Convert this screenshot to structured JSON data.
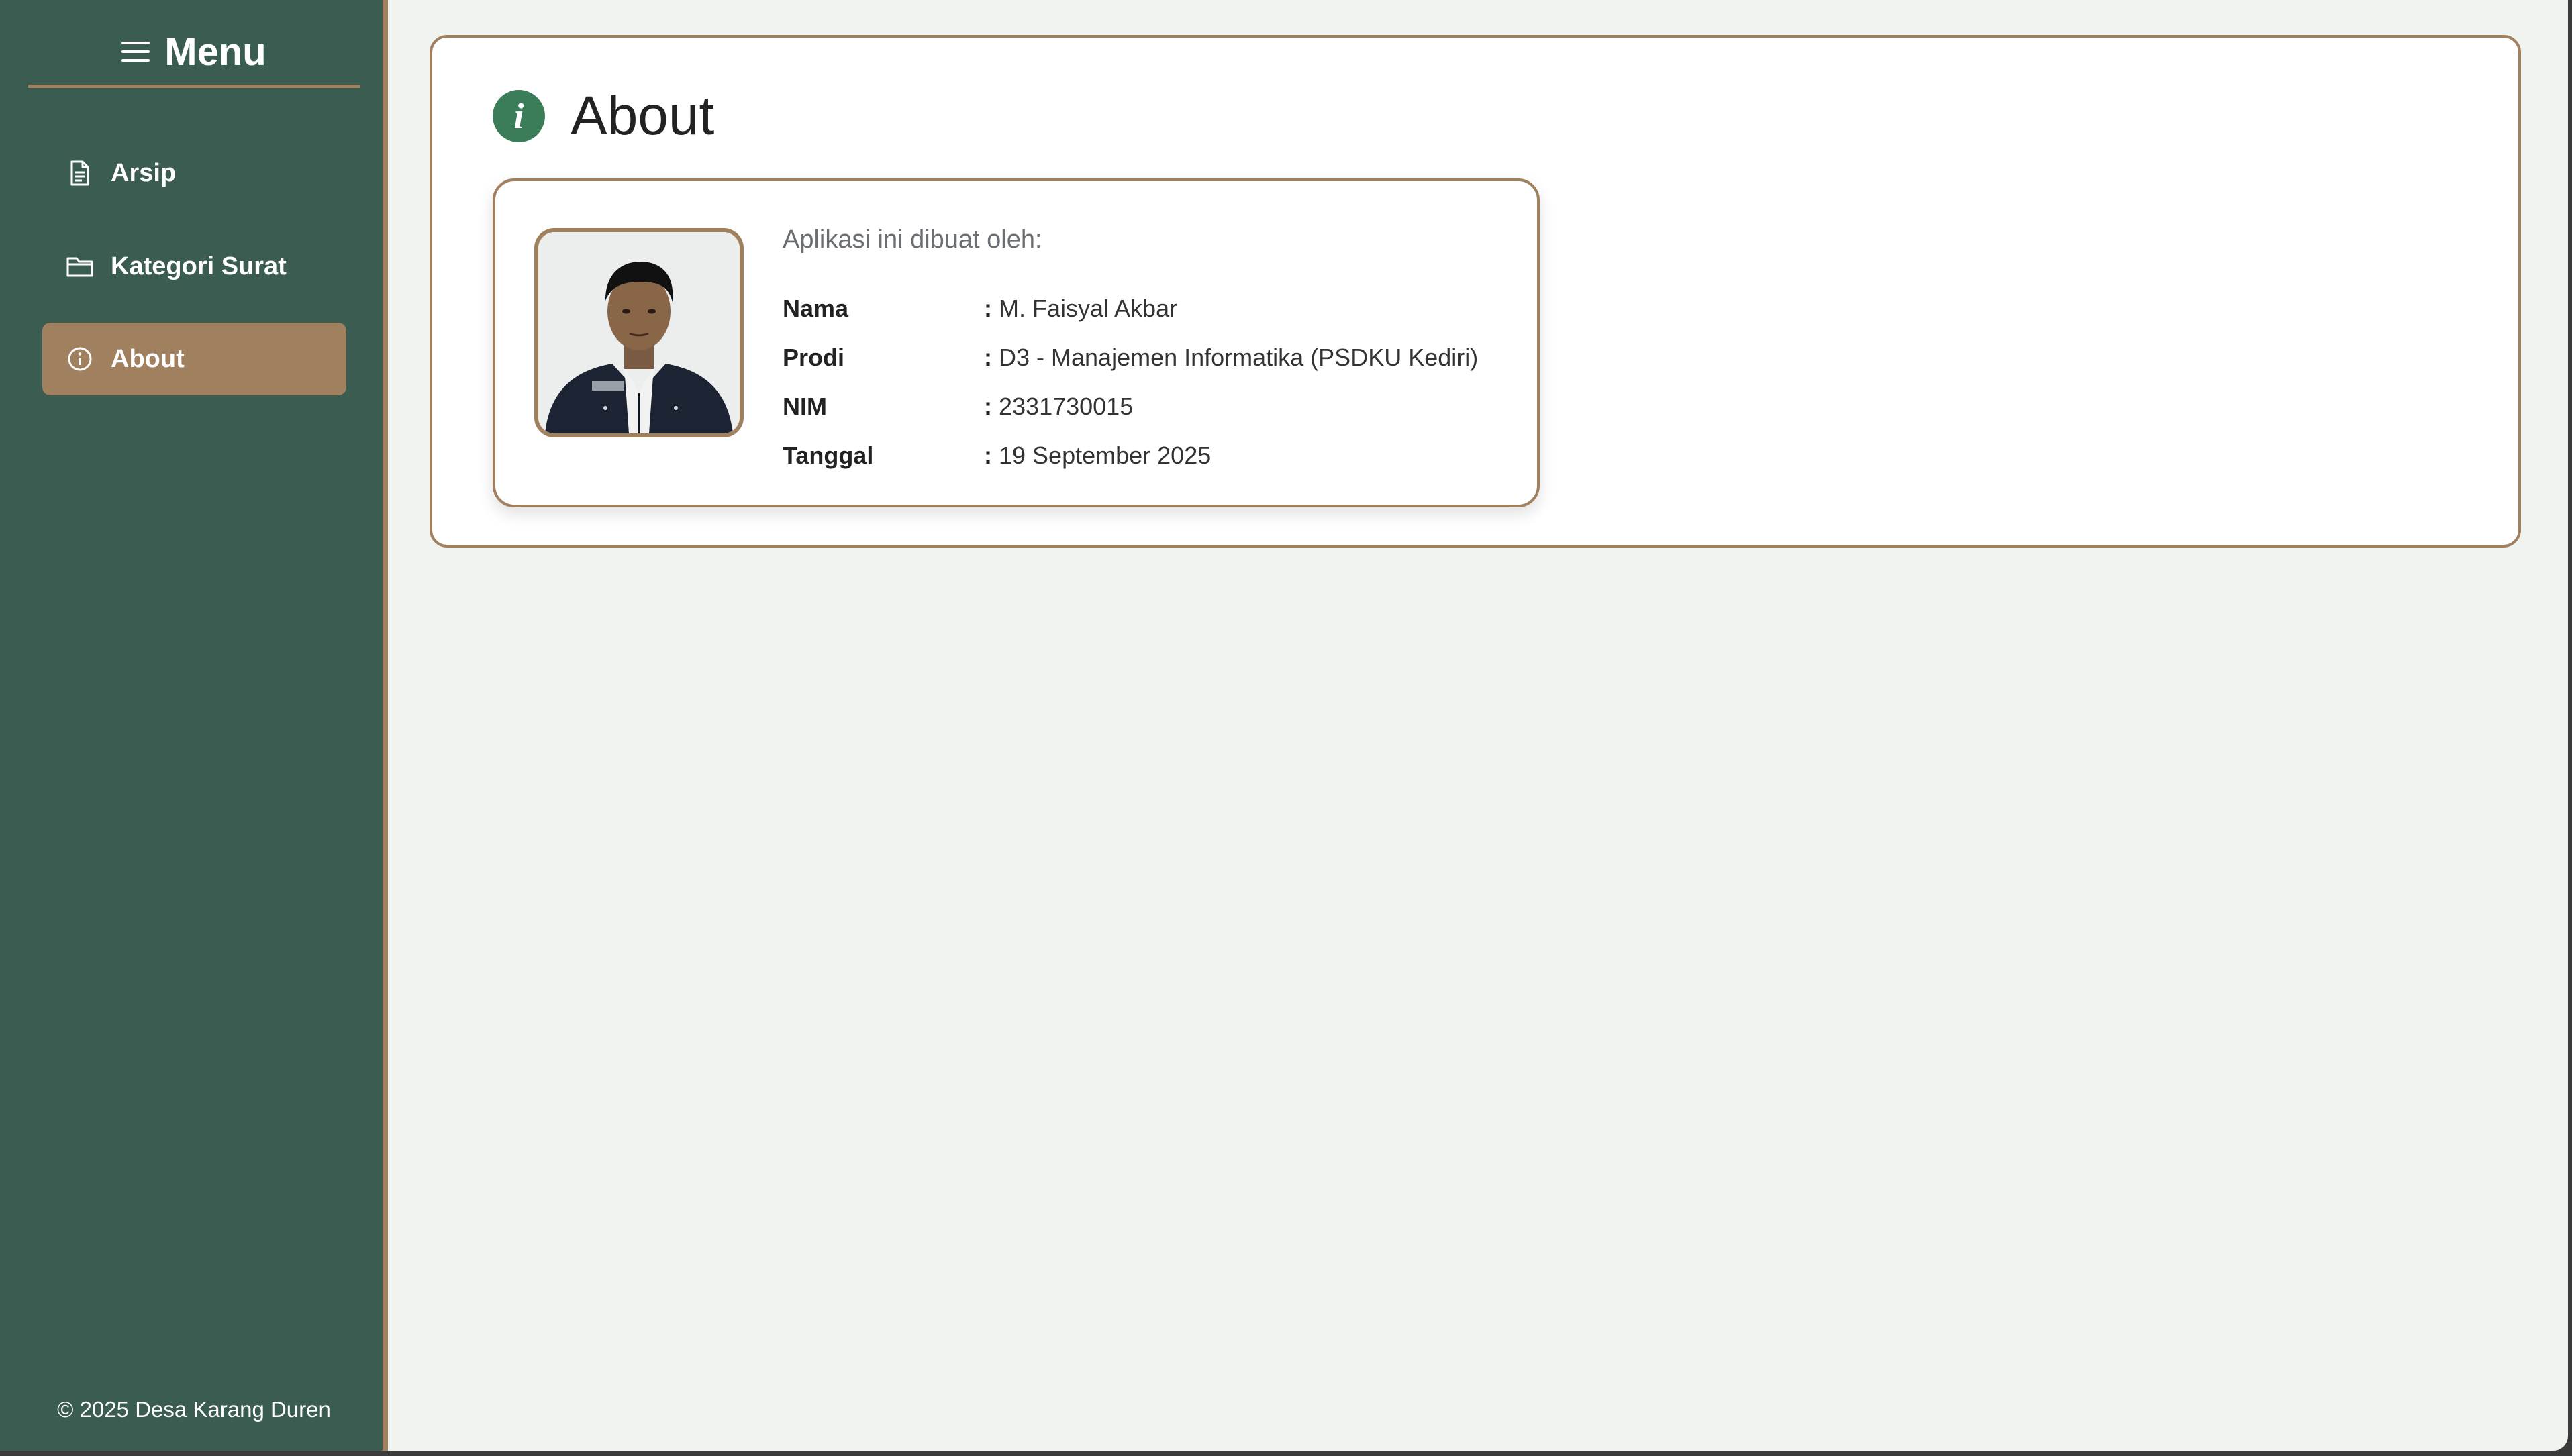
{
  "sidebar": {
    "title": "Menu",
    "items": [
      {
        "label": "Arsip",
        "icon": "document-icon",
        "active": false
      },
      {
        "label": "Kategori Surat",
        "icon": "folder-icon",
        "active": false
      },
      {
        "label": "About",
        "icon": "info-circle-icon",
        "active": true
      }
    ],
    "footer": "© 2025 Desa Karang Duren"
  },
  "main": {
    "title": "About",
    "card": {
      "intro": "Aplikasi ini dibuat oleh:",
      "rows": [
        {
          "key": "Nama",
          "value": "M. Faisyal Akbar"
        },
        {
          "key": "Prodi",
          "value": "D3 - Manajemen Informatika (PSDKU Kediri)"
        },
        {
          "key": "NIM",
          "value": "2331730015"
        },
        {
          "key": "Tanggal",
          "value": "19 September 2025"
        }
      ]
    }
  },
  "colors": {
    "sidebar_bg": "#3b5c51",
    "accent": "#a1805f",
    "info_icon": "#3a7d58",
    "page_bg": "#f1f3ef"
  }
}
